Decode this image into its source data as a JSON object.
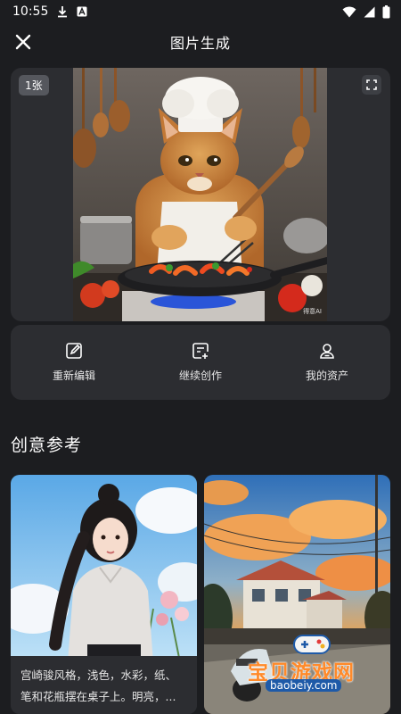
{
  "status_bar": {
    "time": "10:55"
  },
  "header": {
    "title": "图片生成"
  },
  "preview": {
    "count_badge": "1张",
    "image_watermark": "得意AI"
  },
  "actions": [
    {
      "label": "重新编辑",
      "icon": "edit-icon"
    },
    {
      "label": "继续创作",
      "icon": "note-add-icon"
    },
    {
      "label": "我的资产",
      "icon": "person-icon"
    }
  ],
  "inspiration": {
    "section_title": "创意参考",
    "cards": [
      {
        "caption": "宫崎骏风格，浅色，水彩，纸、笔和花瓶摆在桌子上。明亮，..."
      },
      {
        "caption": ""
      }
    ]
  },
  "site_watermark": {
    "brand": "宝贝游戏网",
    "url": "baobeiy.com"
  },
  "colors": {
    "background": "#1c1d20",
    "card": "#2c2d31",
    "accent": "#ff8a2a"
  }
}
